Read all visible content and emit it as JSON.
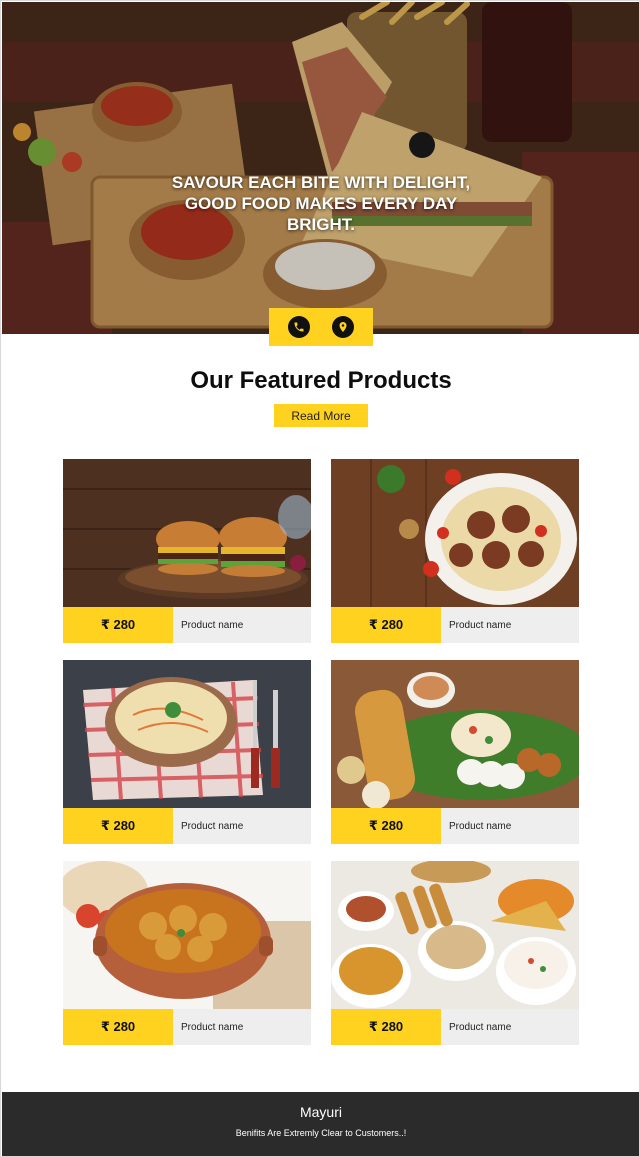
{
  "hero": {
    "lines": [
      "SAVOUR EACH BITE WITH DELIGHT,",
      "GOOD FOOD MAKES EVERY DAY",
      "BRIGHT."
    ],
    "contact_icons": [
      "phone-icon",
      "location-pin-icon"
    ]
  },
  "featured": {
    "title": "Our Featured Products",
    "read_more": "Read More"
  },
  "products": [
    {
      "price": "₹ 280",
      "name": "Product name",
      "image": "burgers"
    },
    {
      "price": "₹ 280",
      "name": "Product name",
      "image": "pasta-meatballs"
    },
    {
      "price": "₹ 280",
      "name": "Product name",
      "image": "noodles"
    },
    {
      "price": "₹ 280",
      "name": "Product name",
      "image": "dosa-platter"
    },
    {
      "price": "₹ 280",
      "name": "Product name",
      "image": "potato-curry"
    },
    {
      "price": "₹ 280",
      "name": "Product name",
      "image": "snack-platter"
    }
  ],
  "footer": {
    "brand": "Mayuri",
    "tagline": "Benifits Are Extremly Clear to Customers..!"
  },
  "colors": {
    "accent": "#ffd21f",
    "footer_bg": "#2b2b2b",
    "name_bg": "#eeeeee"
  }
}
